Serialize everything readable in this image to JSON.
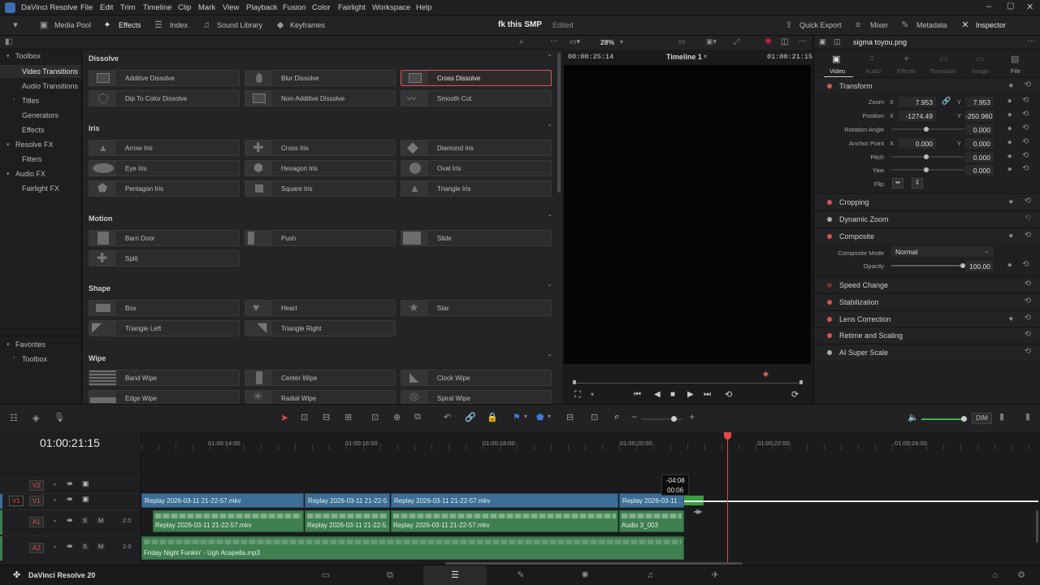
{
  "app": {
    "title": "DaVinci Resolve",
    "brand_footer": "DaVinci Resolve 20",
    "menu": [
      "File",
      "Edit",
      "Trim",
      "Timeline",
      "Clip",
      "Mark",
      "View",
      "Playback",
      "Fusion",
      "Color",
      "Fairlight",
      "Workspace",
      "Help"
    ]
  },
  "toolbar": {
    "media_pool": "Media Pool",
    "effects": "Effects",
    "index": "Index",
    "sound_library": "Sound Library",
    "keyframes": "Keyframes",
    "project_name": "fk this SMP",
    "project_status": "Edited",
    "quick_export": "Quick Export",
    "mixer": "Mixer",
    "metadata": "Metadata",
    "inspector": "Inspector"
  },
  "toolbox": {
    "items": [
      "Toolbox",
      "Video Transitions",
      "Audio Transitions",
      "Titles",
      "Generators",
      "Effects",
      "Resolve FX",
      "Filters",
      "Audio FX",
      "Fairlight FX"
    ],
    "favorites": "Favorites",
    "favorites_toolbox": "Toolbox"
  },
  "effects_panel": {
    "sections": {
      "dissolve": "Dissolve",
      "iris": "Iris",
      "motion": "Motion",
      "shape": "Shape",
      "wipe": "Wipe"
    },
    "dissolve": [
      "Additive Dissolve",
      "Blur Dissolve",
      "Cross Dissolve",
      "Dip To Color Dissolve",
      "Non-Additive Dissolve",
      "Smooth Cut"
    ],
    "iris": [
      "Arrow Iris",
      "Cross Iris",
      "Diamond Iris",
      "Eye Iris",
      "Hexagon Iris",
      "Oval Iris",
      "Pentagon Iris",
      "Square Iris",
      "Triangle Iris"
    ],
    "motion": [
      "Barn Door",
      "Push",
      "Slide",
      "Split"
    ],
    "shape": [
      "Box",
      "Heart",
      "Star",
      "Triangle Left",
      "Triangle Right"
    ],
    "wipe": [
      "Band Wipe",
      "Center Wipe",
      "Clock Wipe",
      "Edge Wipe",
      "Radial Wipe",
      "Spiral Wipe"
    ]
  },
  "viewer": {
    "zoom": "28%",
    "source_tc": "00:00:25:14",
    "timeline_name": "Timeline 1",
    "record_tc": "01:00:21:15"
  },
  "inspector": {
    "clip_name": "sigma toyou.png",
    "tabs": [
      "Video",
      "Audio",
      "Effects",
      "Transition",
      "Image",
      "File"
    ],
    "transform": "Transform",
    "zoom_label": "Zoom",
    "zoom_x": "7.953",
    "zoom_y": "7.953",
    "position_label": "Position",
    "position_x": "-1274.49",
    "position_y": "-250.960",
    "rotation_label": "Rotation Angle",
    "rotation": "0.000",
    "anchor_label": "Anchor Point",
    "anchor_x": "0.000",
    "anchor_y": "0.000",
    "pitch_label": "Pitch",
    "pitch": "0.000",
    "yaw_label": "Yaw",
    "yaw": "0.000",
    "flip_label": "Flip",
    "x": "X",
    "y": "Y",
    "cropping": "Cropping",
    "dynamic_zoom": "Dynamic Zoom",
    "composite": "Composite",
    "composite_mode_label": "Composite Mode",
    "composite_mode": "Normal",
    "opacity_label": "Opacity",
    "opacity": "100.00",
    "speed_change": "Speed Change",
    "stabilization": "Stabilization",
    "lens_correction": "Lens Correction",
    "retime_scaling": "Retime and Scaling",
    "ai_super_scale": "AI Super Scale"
  },
  "timeline": {
    "timecode": "01:00:21:15",
    "ruler": [
      "01:00:14:00",
      "01:00:16:00",
      "01:00:18:00",
      "01:00:20:00",
      "01:00:22:00",
      "01:00:24:00"
    ],
    "dim": "DIM",
    "tracks": {
      "v2": "V2",
      "v1": "V1",
      "v1_src": "V1",
      "a1": "A1",
      "a2": "A2",
      "a1_ch": "2.0",
      "a2_ch": "2.0",
      "s": "S",
      "m": "M"
    },
    "video_clips": [
      "Replay 2026-03-11 21-22-57.mkv",
      "Replay 2026-03-11 21-22-5...",
      "Replay 2026-03-11 21-22-57.mkv",
      "Replay 2026-03-11 ..."
    ],
    "audio_clips": [
      "Replay 2026-03-11 21-22-57.mkv",
      "Replay 2026-03-11 21-22-5...",
      "Replay 2026-03-11 21-22-57.mkv",
      "Audio 3_003"
    ],
    "a2_clip": "Friday Night Funkin' - Ugh Acapella.mp3",
    "trim_tooltip_delta": "-04:08",
    "trim_tooltip_dur": "00:06"
  },
  "colors": {
    "accent_red": "#d9534f",
    "video_clip": "#3d6e95",
    "audio_clip": "#3f7f50"
  }
}
